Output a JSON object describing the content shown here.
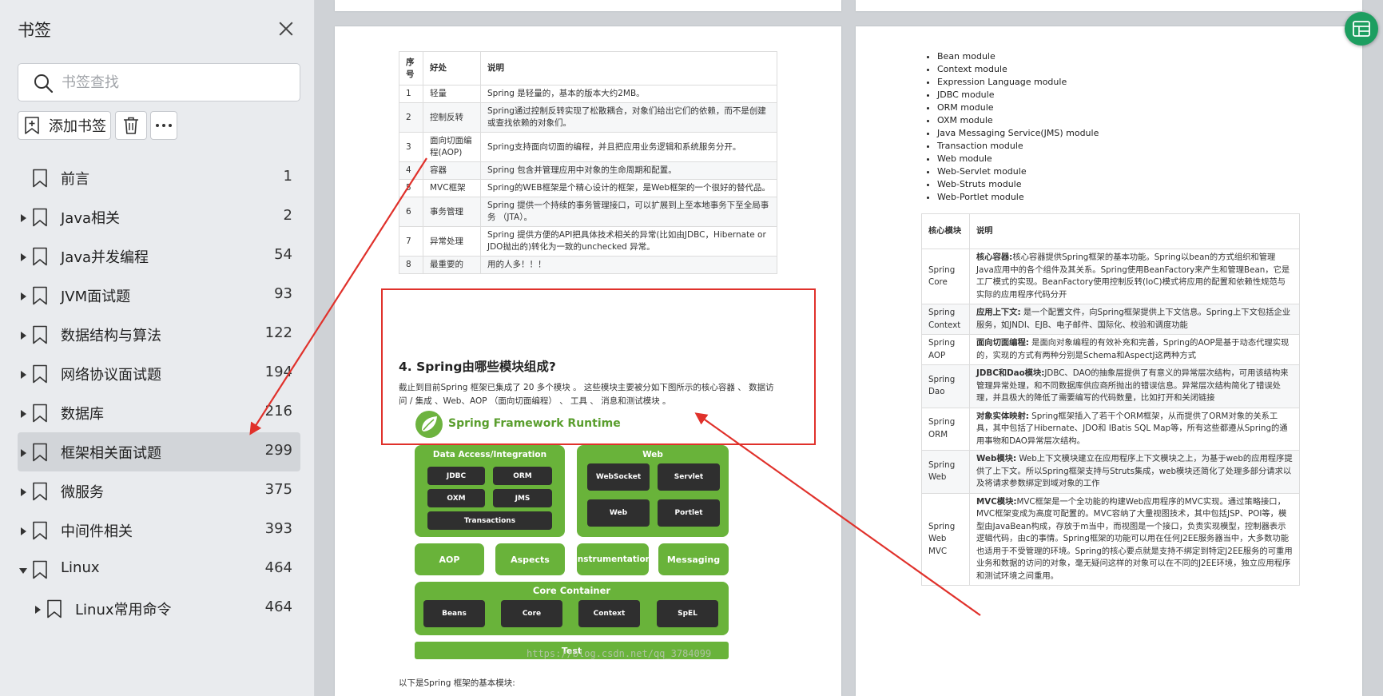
{
  "sidebar": {
    "title": "书签",
    "search_placeholder": "书签查找",
    "add_label": "添加书签",
    "items": [
      {
        "label": "前言",
        "page": "1"
      },
      {
        "label": "Java相关",
        "page": "2"
      },
      {
        "label": "Java并发编程",
        "page": "54"
      },
      {
        "label": "JVM面试题",
        "page": "93"
      },
      {
        "label": "数据结构与算法",
        "page": "122"
      },
      {
        "label": "网络协议面试题",
        "page": "194"
      },
      {
        "label": "数据库",
        "page": "216"
      },
      {
        "label": "框架相关面试题",
        "page": "299"
      },
      {
        "label": "微服务",
        "page": "375"
      },
      {
        "label": "中间件相关",
        "page": "393"
      },
      {
        "label": "Linux",
        "page": "464"
      },
      {
        "label": "Linux常用命令",
        "page": "464"
      }
    ]
  },
  "left_page": {
    "table": {
      "headers": [
        "序号",
        "好处",
        "说明"
      ],
      "rows": [
        [
          "1",
          "轻量",
          "Spring 是轻量的，基本的版本大约2MB。"
        ],
        [
          "2",
          "控制反转",
          "Spring通过控制反转实现了松散耦合，对象们给出它们的依赖，而不是创建或查找依赖的对象们。"
        ],
        [
          "3",
          "面向切面编程(AOP)",
          "Spring支持面向切面的编程，并且把应用业务逻辑和系统服务分开。"
        ],
        [
          "4",
          "容器",
          "Spring 包含并管理应用中对象的生命周期和配置。"
        ],
        [
          "5",
          "MVC框架",
          "Spring的WEB框架是个精心设计的框架，是Web框架的一个很好的替代品。"
        ],
        [
          "6",
          "事务管理",
          "Spring 提供一个持续的事务管理接口，可以扩展到上至本地事务下至全局事务 （JTA）。"
        ],
        [
          "7",
          "异常处理",
          "Spring 提供方便的API把具体技术相关的异常(比如由JDBC，Hibernate or JDO抛出的)转化为一致的unchecked 异常。"
        ],
        [
          "8",
          "最重要的",
          "用的人多！！！"
        ]
      ]
    },
    "heading": "4. Spring由哪些模块组成?",
    "description": "截止到目前Spring 框架已集成了 20 多个模块 。 这些模块主要被分如下图所示的核心容器 、 数据访问 / 集成 、Web、AOP （面向切面编程） 、 工具 、 消息和测试模块 。",
    "diagram": {
      "title": "Spring Framework Runtime",
      "data_access": {
        "label": "Data Access/Integration",
        "items": [
          "JDBC",
          "ORM",
          "OXM",
          "JMS",
          "Transactions"
        ]
      },
      "web": {
        "label": "Web",
        "items": [
          "WebSocket",
          "Servlet",
          "Web",
          "Portlet"
        ]
      },
      "middle": [
        "AOP",
        "Aspects",
        "Instrumentation",
        "Messaging"
      ],
      "core": {
        "label": "Core Container",
        "items": [
          "Beans",
          "Core",
          "Context",
          "SpEL"
        ]
      },
      "test": "Test",
      "watermark": "https://blog.csdn.net/qq_3784099"
    },
    "after_text": "以下是Spring 框架的基本模块:"
  },
  "right_page": {
    "modules": [
      "Bean module",
      "Context module",
      "Expression Language module",
      "JDBC module",
      "ORM module",
      "OXM module",
      "Java Messaging Service(JMS) module",
      "Transaction module",
      "Web module",
      "Web-Servlet module",
      "Web-Struts module",
      "Web-Portlet module"
    ],
    "table": {
      "headers": [
        "核心模块",
        "说明"
      ],
      "rows": [
        {
          "name": "Spring Core",
          "term": "核心容器:",
          "text": "核心容器提供Spring框架的基本功能。Spring以bean的方式组织和管理Java应用中的各个组件及其关系。Spring使用BeanFactory来产生和管理Bean，它是工厂模式的实现。BeanFactory使用控制反转(IoC)模式将应用的配置和依赖性规范与实际的应用程序代码分开"
        },
        {
          "name": "Spring Context",
          "term": "应用上下文:",
          "text": " 是一个配置文件，向Spring框架提供上下文信息。Spring上下文包括企业服务，如JNDI、EJB、电子邮件、国际化、校验和调度功能"
        },
        {
          "name": "Spring AOP",
          "term": "面向切面编程:",
          "text": " 是面向对象编程的有效补充和完善，Spring的AOP是基于动态代理实现的，实现的方式有两种分别是Schema和AspectJ这两种方式"
        },
        {
          "name": "Spring Dao",
          "term": "JDBC和Dao模块:",
          "text": "JDBC、DAO的抽象层提供了有意义的异常层次结构，可用该结构来管理异常处理，和不同数据库供应商所抛出的错误信息。异常层次结构简化了错误处理，并且极大的降低了需要编写的代码数量，比如打开和关闭链接"
        },
        {
          "name": "Spring ORM",
          "term": "对象实体映射:",
          "text": " Spring框架插入了若干个ORM框架，从而提供了ORM对象的关系工具，其中包括了Hibernate、JDO和 IBatis SQL Map等，所有这些都遵从Spring的通用事物和DAO异常层次结构。"
        },
        {
          "name": "Spring Web",
          "term": "Web模块:",
          "text": " Web上下文模块建立在应用程序上下文模块之上，为基于web的应用程序提供了上下文。所以Spring框架支持与Struts集成，web模块还简化了处理多部分请求以及将请求参数绑定到域对象的工作"
        },
        {
          "name": "Spring Web MVC",
          "term": "MVC模块:",
          "text": "MVC框架是一个全功能的构建Web应用程序的MVC实现。通过策略接口，MVC框架变成为高度可配置的。MVC容纳了大量视图技术，其中包括JSP、POI等，模型由JavaBean构成，存放于m当中，而视图是一个接口，负责实现模型，控制器表示逻辑代码，由c的事情。Spring框架的功能可以用在任何J2EE服务器当中，大多数功能也适用于不受管理的环境。Spring的核心要点就是支持不绑定到特定J2EE服务的可重用业务和数据的访问的对象，毫无疑问这样的对象可以在不同的J2EE环境，独立应用程序和测试环境之间重用。"
        }
      ]
    }
  },
  "colors": {
    "annotation_red": "#e0312b",
    "spring_green": "#69b33a",
    "fab_green": "#1d9e60"
  }
}
